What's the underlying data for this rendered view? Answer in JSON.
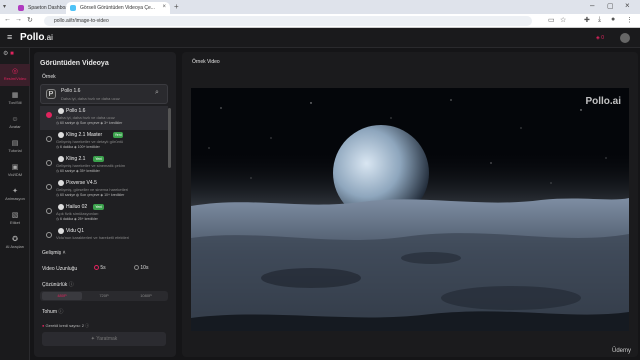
{
  "browser": {
    "tabs": [
      {
        "title": "Spaeton Dashboard"
      },
      {
        "title": "Görseli Görüntüden Videoya Çe..."
      }
    ],
    "new_tab": "+",
    "address": "pollo.ai/tr/image-to-video"
  },
  "app": {
    "logo": "Pollo",
    "logo_suffix": ".ai",
    "credits": "0"
  },
  "nav": [
    {
      "label": "Resim/Video",
      "icon": "◎"
    },
    {
      "label": "Ton/Stil",
      "icon": "▦"
    },
    {
      "label": "Avatar",
      "icon": "☺"
    },
    {
      "label": "Tutorial",
      "icon": "▤"
    },
    {
      "label": "Vid/IDM",
      "icon": "▣"
    },
    {
      "label": "Animasyon",
      "icon": "✦"
    },
    {
      "label": "Etiket",
      "icon": "▧"
    },
    {
      "label": "AI Araçları",
      "icon": "✪"
    }
  ],
  "panel": {
    "title": "Görüntüden Videoya",
    "section": "Örnek",
    "selected_model": "Pollo 1.6",
    "selected_desc": "Daha iyi, daha hızlı ve daha ucuz",
    "models": [
      {
        "name": "Pollo 1.6",
        "desc": "Daha iyi, daha hızlı ve daha ucuz",
        "chips": "◷ 60 saniye   ◍ Son çerçeve   ◈ 3+ kredikler",
        "badge": ""
      },
      {
        "name": "Kling 2.1 Master",
        "desc": "Gelişmiş hareketler ve detaylı görüntü",
        "chips": "◷ 6 dakika   ◈ 100+ kredikler",
        "badge": "Yeni"
      },
      {
        "name": "Kling 2.1",
        "desc": "Gelişmiş hareketler ve sinematik çekim",
        "chips": "◷ 60 saniye   ◈ 35+ kredikler",
        "badge": "Yeni"
      },
      {
        "name": "Pixverse V4.5",
        "desc": "Gelişmiş, görseller ve sinema hareketleri",
        "chips": "◷ 60 saniye   ◍ Son çerçeve   ◈ 10+ kredikler",
        "badge": ""
      },
      {
        "name": "Hailuo 02",
        "desc": "Açık fizik simülasyonları",
        "chips": "◷ 6 dakika   ◈ 25+ kredikler",
        "badge": "Yeni"
      },
      {
        "name": "Vidu Q1",
        "desc": "Vidu'nun karakterleri ve hareketli efektleri",
        "chips": "",
        "badge": ""
      }
    ],
    "clarity_label": "Gelişmiş",
    "duration_label": "Video Uzunluğu",
    "duration_options": [
      "5s",
      "10s"
    ],
    "resolution_label": "Çözünürlük",
    "resolution_options": [
      "480P",
      "720P",
      "1080P"
    ],
    "seed_label": "Tohum",
    "credits_note": "Gerekli kredi sayısı: 2",
    "generate_button": "Yaratmak"
  },
  "preview": {
    "label": "Örnek Video",
    "watermark": "Pollo.ai"
  },
  "overlay": {
    "brand": "Ūdemy"
  },
  "colors": {
    "accent": "#e0245e",
    "panel": "#1f1f22",
    "background": "#151517"
  }
}
